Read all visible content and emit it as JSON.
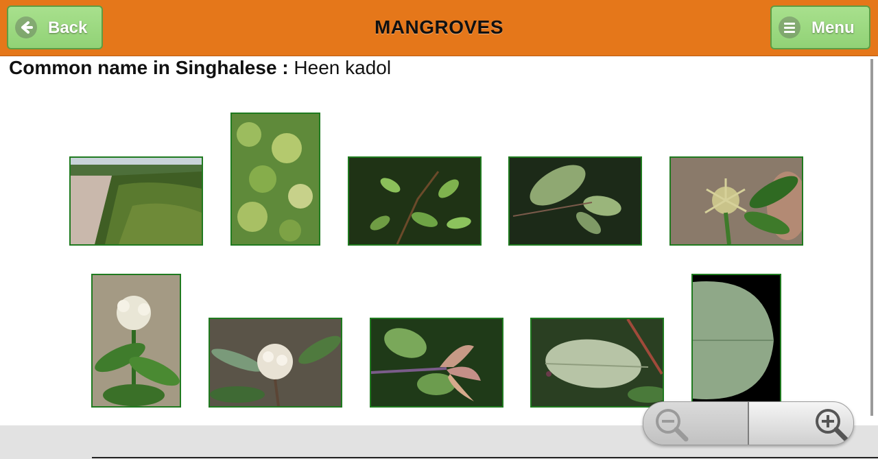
{
  "header": {
    "title": "MANGROVES",
    "back_label": "Back",
    "menu_label": "Menu"
  },
  "common_name": {
    "label": "Common name in Singhalese :",
    "value": "Heen kadol"
  },
  "gallery": {
    "row1": [
      "mangrove-stand-photo",
      "shrub-foliage-photo",
      "branch-leaves-photo",
      "leaf-pair-photo",
      "spiky-propagule-photo"
    ],
    "row2": [
      "white-flower-cluster-photo",
      "flower-closeup-photo",
      "curled-buds-photo",
      "leaf-underside-photo",
      "large-leaf-photo"
    ]
  },
  "zoom": {
    "out_icon": "zoom-out-icon",
    "in_icon": "zoom-in-icon"
  },
  "colors": {
    "header_bg": "#e5771a",
    "button_bg": "#9bd67f",
    "thumb_border": "#1f7a1f"
  }
}
